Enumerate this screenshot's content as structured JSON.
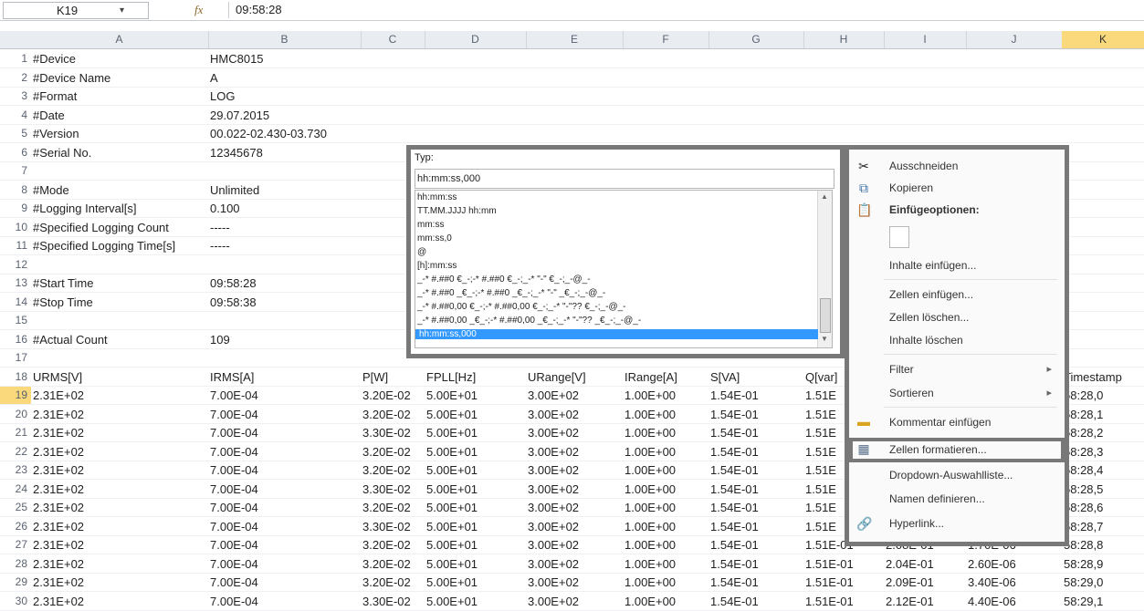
{
  "formula_bar": {
    "name_box": "K19",
    "fx_label": "fx",
    "formula": "09:58:28"
  },
  "columns": [
    "A",
    "B",
    "C",
    "D",
    "E",
    "F",
    "G",
    "H",
    "I",
    "J",
    "K"
  ],
  "selected_column": "K",
  "rows": [
    {
      "n": "1",
      "A": "#Device",
      "B": "HMC8015"
    },
    {
      "n": "2",
      "A": "#Device Name",
      "B": "A"
    },
    {
      "n": "3",
      "A": "#Format",
      "B": "LOG"
    },
    {
      "n": "4",
      "A": "#Date",
      "B": "29.07.2015"
    },
    {
      "n": "5",
      "A": "#Version",
      "B": "00.022-02.430-03.730"
    },
    {
      "n": "6",
      "A": "#Serial No.",
      "B": "12345678"
    },
    {
      "n": "7",
      "A": "",
      "B": ""
    },
    {
      "n": "8",
      "A": "#Mode",
      "B": "Unlimited"
    },
    {
      "n": "9",
      "A": "#Logging Interval[s]",
      "B": "0.100"
    },
    {
      "n": "10",
      "A": "#Specified Logging Count",
      "B": "-----"
    },
    {
      "n": "11",
      "A": "#Specified Logging Time[s]",
      "B": "-----"
    },
    {
      "n": "12",
      "A": "",
      "B": ""
    },
    {
      "n": "13",
      "A": "#Start Time",
      "B": "09:58:28"
    },
    {
      "n": "14",
      "A": "#Stop Time",
      "B": "09:58:38"
    },
    {
      "n": "15",
      "A": "",
      "B": ""
    },
    {
      "n": "16",
      "A": "#Actual Count",
      "B": "109"
    },
    {
      "n": "17",
      "A": "",
      "B": ""
    }
  ],
  "table_header_row": {
    "n": "18",
    "cells": [
      "URMS[V]",
      "IRMS[A]",
      "P[W]",
      "FPLL[Hz]",
      "URange[V]",
      "IRange[A]",
      "S[VA]",
      "Q[var]",
      "",
      "",
      "Timestamp"
    ]
  },
  "data_rows": [
    {
      "n": "19",
      "cells": [
        "2.31E+02",
        "7.00E-04",
        "3.20E-02",
        "5.00E+01",
        "3.00E+02",
        "1.00E+00",
        "1.54E-01",
        "1.51E",
        "",
        "",
        "58:28,0"
      ]
    },
    {
      "n": "20",
      "cells": [
        "2.31E+02",
        "7.00E-04",
        "3.20E-02",
        "5.00E+01",
        "3.00E+02",
        "1.00E+00",
        "1.54E-01",
        "1.51E",
        "",
        "",
        "58:28,1"
      ]
    },
    {
      "n": "21",
      "cells": [
        "2.31E+02",
        "7.00E-04",
        "3.30E-02",
        "5.00E+01",
        "3.00E+02",
        "1.00E+00",
        "1.54E-01",
        "1.51E",
        "",
        "",
        "58:28,2"
      ]
    },
    {
      "n": "22",
      "cells": [
        "2.31E+02",
        "7.00E-04",
        "3.20E-02",
        "5.00E+01",
        "3.00E+02",
        "1.00E+00",
        "1.54E-01",
        "1.51E",
        "",
        "",
        "58:28,3"
      ]
    },
    {
      "n": "23",
      "cells": [
        "2.31E+02",
        "7.00E-04",
        "3.20E-02",
        "5.00E+01",
        "3.00E+02",
        "1.00E+00",
        "1.54E-01",
        "1.51E",
        "",
        "",
        "58:28,4"
      ]
    },
    {
      "n": "24",
      "cells": [
        "2.31E+02",
        "7.00E-04",
        "3.30E-02",
        "5.00E+01",
        "3.00E+02",
        "1.00E+00",
        "1.54E-01",
        "1.51E",
        "",
        "",
        "58:28,5"
      ]
    },
    {
      "n": "25",
      "cells": [
        "2.31E+02",
        "7.00E-04",
        "3.20E-02",
        "5.00E+01",
        "3.00E+02",
        "1.00E+00",
        "1.54E-01",
        "1.51E",
        "",
        "",
        "58:28,6"
      ]
    },
    {
      "n": "26",
      "cells": [
        "2.31E+02",
        "7.00E-04",
        "3.30E-02",
        "5.00E+01",
        "3.00E+02",
        "1.00E+00",
        "1.54E-01",
        "1.51E",
        "",
        "",
        "58:28,7"
      ]
    },
    {
      "n": "27",
      "cells": [
        "2.31E+02",
        "7.00E-04",
        "3.20E-02",
        "5.00E+01",
        "3.00E+02",
        "1.00E+00",
        "1.54E-01",
        "1.51E-01",
        "2.08E-01",
        "1.70E-06",
        "58:28,8"
      ]
    },
    {
      "n": "28",
      "cells": [
        "2.31E+02",
        "7.00E-04",
        "3.20E-02",
        "5.00E+01",
        "3.00E+02",
        "1.00E+00",
        "1.54E-01",
        "1.51E-01",
        "2.04E-01",
        "2.60E-06",
        "58:28,9"
      ]
    },
    {
      "n": "29",
      "cells": [
        "2.31E+02",
        "7.00E-04",
        "3.20E-02",
        "5.00E+01",
        "3.00E+02",
        "1.00E+00",
        "1.54E-01",
        "1.51E-01",
        "2.09E-01",
        "3.40E-06",
        "58:29,0"
      ]
    },
    {
      "n": "30",
      "cells": [
        "2.31E+02",
        "7.00E-04",
        "3.30E-02",
        "5.00E+01",
        "3.00E+02",
        "1.00E+00",
        "1.54E-01",
        "1.51E-01",
        "2.12E-01",
        "4.40E-06",
        "58:29,1"
      ]
    }
  ],
  "format_dialog": {
    "type_label": "Typ:",
    "type_value": "hh:mm:ss,000",
    "options": [
      "hh:mm:ss",
      "TT.MM.JJJJ hh:mm",
      "mm:ss",
      "mm:ss,0",
      "@",
      "[h]:mm:ss",
      "_-* #.##0 €_-;-* #.##0 €_-;_-* \"-\" €_-;_-@_-",
      "_-* #.##0 _€_-;-* #.##0 _€_-;_-* \"-\" _€_-;_-@_-",
      "_-* #.##0,00 €_-;-* #.##0,00 €_-;_-* \"-\"?? €_-;_-@_-",
      "_-* #.##0,00 _€_-;-* #.##0,00 _€_-;_-* \"-\"?? _€_-;_-@_-",
      "hh:mm:ss,000"
    ]
  },
  "context_menu": {
    "cut": "Ausschneiden",
    "copy": "Kopieren",
    "paste_options": "Einfügeoptionen:",
    "paste_special": "Inhalte einfügen...",
    "insert_cells": "Zellen einfügen...",
    "delete_cells": "Zellen löschen...",
    "clear_contents": "Inhalte löschen",
    "filter": "Filter",
    "sort": "Sortieren",
    "insert_comment": "Kommentar einfügen",
    "format_cells": "Zellen formatieren...",
    "dropdown_list": "Dropdown-Auswahlliste...",
    "define_name": "Namen definieren...",
    "hyperlink": "Hyperlink..."
  },
  "colors": {
    "selection": "#f9d97b",
    "list_highlight": "#3399ff",
    "dialog_border": "#787878"
  }
}
